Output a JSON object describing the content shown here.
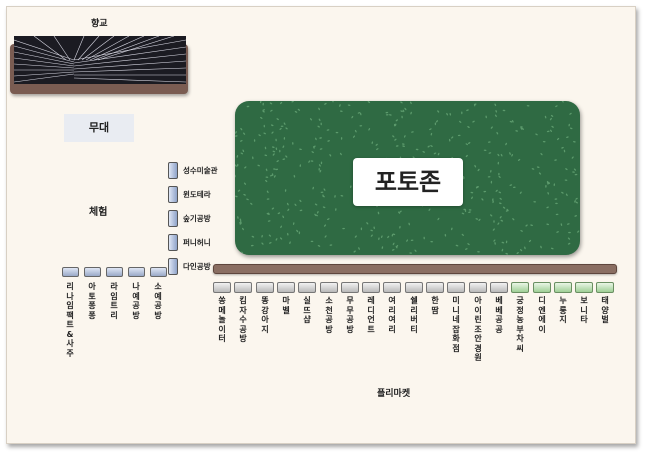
{
  "gallery": {
    "title": "향교"
  },
  "stage": {
    "label": "무대"
  },
  "lawn": {
    "label": "포토존",
    "color": "#2f6a43"
  },
  "experience": {
    "title": "체험",
    "column_booths": [
      "성수미술관",
      "윈도테라",
      "숲기공방",
      "퍼니허니",
      "다인공방"
    ],
    "row_booths": [
      "리나임팩트&사주",
      "아토퐁퐁",
      "라임트리",
      "나예공방",
      "소예공방"
    ]
  },
  "flea_market": {
    "title": "플리마켓",
    "booths": [
      {
        "name": "쏭메놀이터",
        "color": "grey"
      },
      {
        "name": "킴자수공방",
        "color": "grey"
      },
      {
        "name": "똥강아지",
        "color": "grey"
      },
      {
        "name": "마벨",
        "color": "grey"
      },
      {
        "name": "실뜨샵",
        "color": "grey"
      },
      {
        "name": "소천공방",
        "color": "grey"
      },
      {
        "name": "무무공방",
        "color": "grey"
      },
      {
        "name": "레디언트",
        "color": "grey"
      },
      {
        "name": "여리여리",
        "color": "grey"
      },
      {
        "name": "쉘리버티",
        "color": "grey"
      },
      {
        "name": "한땀",
        "color": "grey"
      },
      {
        "name": "미니네잡화점",
        "color": "grey"
      },
      {
        "name": "아이린조안경원",
        "color": "grey"
      },
      {
        "name": "베베공공",
        "color": "grey"
      },
      {
        "name": "궁정농부차씨",
        "color": "green"
      },
      {
        "name": "디엔에이",
        "color": "green"
      },
      {
        "name": "누룽지",
        "color": "green"
      },
      {
        "name": "보니타",
        "color": "green"
      },
      {
        "name": "태양벌",
        "color": "green"
      }
    ]
  }
}
